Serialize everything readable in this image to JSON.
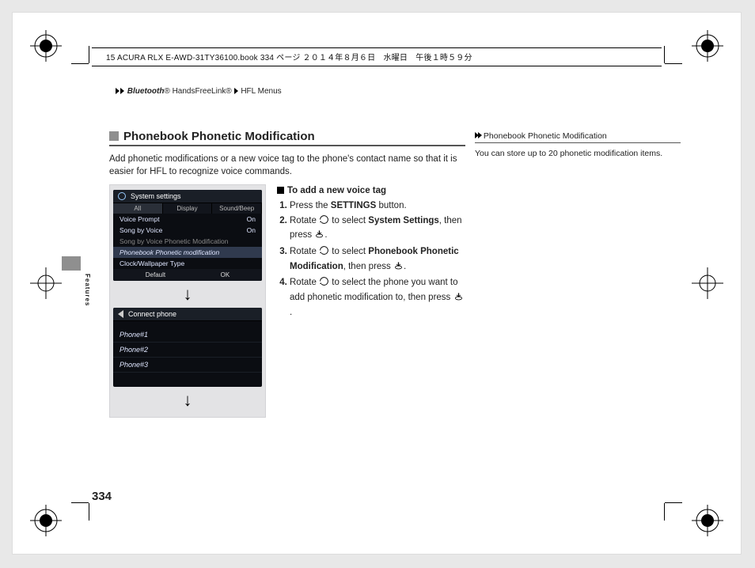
{
  "header_line": "15 ACURA RLX E-AWD-31TY36100.book  334 ページ  ２０１４年８月６日　水曜日　午後１時５９分",
  "breadcrumb": {
    "a": "Bluetooth",
    "a_suffix": "® HandsFreeLink®",
    "b": "HFL Menus"
  },
  "sidebar_label": "Features",
  "section_title": "Phonebook Phonetic Modification",
  "intro": "Add phonetic modifications or a new voice tag to the phone's contact name so that it is easier for HFL to recognize voice commands.",
  "subhead": "To add a new voice tag",
  "steps": {
    "s1_a": "Press the ",
    "s1_b": "SETTINGS",
    "s1_c": " button.",
    "s2_a": "Rotate ",
    "s2_b": " to select ",
    "s2_c": "System Settings",
    "s2_d": ", then press ",
    "s2_e": ".",
    "s3_a": "Rotate ",
    "s3_b": " to select ",
    "s3_c": "Phonebook Phonetic Modification",
    "s3_d": ", then press ",
    "s3_e": ".",
    "s4_a": "Rotate ",
    "s4_b": " to select the phone you want to add phonetic modification to, then press ",
    "s4_c": "."
  },
  "screen1": {
    "title": "System settings",
    "tabs": {
      "t1": "All",
      "t2": "Display",
      "t3": "Sound/Beep"
    },
    "r1": {
      "l": "Voice Prompt",
      "v": "On"
    },
    "r2": {
      "l": "Song by Voice",
      "v": "On"
    },
    "r3": {
      "l": "Song by Voice Phonetic Modification",
      "v": ""
    },
    "r4": {
      "l": "Phonebook Phonetic modification",
      "v": ""
    },
    "r5": {
      "l": "Clock/Wallpaper Type",
      "v": ""
    },
    "foot": {
      "a": "Default",
      "b": "OK"
    }
  },
  "screen2": {
    "title": "Connect phone",
    "r1": "Phone#1",
    "r2": "Phone#2",
    "r3": "Phone#3"
  },
  "right": {
    "heading": "Phonebook Phonetic Modification",
    "note": "You can store up to 20 phonetic modification items."
  },
  "page_number": "334"
}
